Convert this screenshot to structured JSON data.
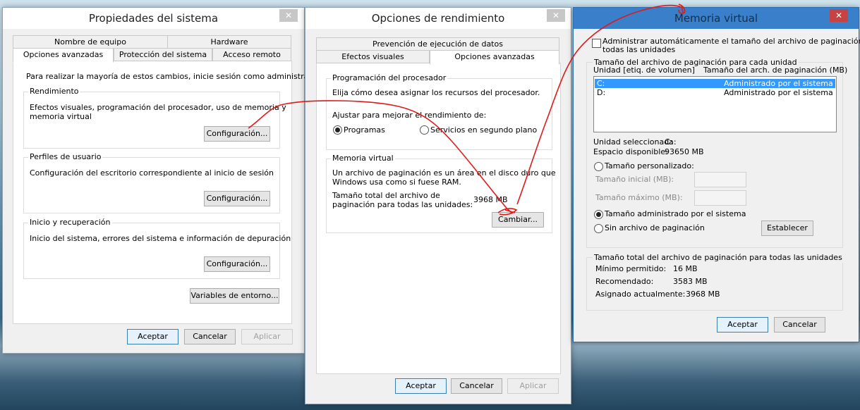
{
  "win1": {
    "title": "Propiedades del sistema",
    "tabs_row1": [
      "Nombre de equipo",
      "Hardware"
    ],
    "tabs_row2": [
      "Opciones avanzadas",
      "Protección del sistema",
      "Acceso remoto"
    ],
    "admin_note": "Para realizar la mayoría de estos cambios, inicie sesión como administrador.",
    "perf": {
      "label": "Rendimiento",
      "desc1": "Efectos visuales, programación del procesador, uso de memoria y",
      "desc2": "memoria virtual",
      "button": "Configuración..."
    },
    "profiles": {
      "label": "Perfiles de usuario",
      "desc": "Configuración del escritorio correspondiente al inicio de sesión",
      "button": "Configuración..."
    },
    "startup": {
      "label": "Inicio y recuperación",
      "desc": "Inicio del sistema, errores del sistema e información de depuración",
      "button": "Configuración..."
    },
    "env_button": "Variables de entorno...",
    "ok": "Aceptar",
    "cancel": "Cancelar",
    "apply": "Aplicar"
  },
  "win2": {
    "title": "Opciones de rendimiento",
    "tabs_row1": [
      "Prevención de ejecución de datos"
    ],
    "tabs_row2": [
      "Efectos visuales",
      "Opciones avanzadas"
    ],
    "cpu": {
      "label": "Programación del procesador",
      "desc": "Elija cómo desea asignar los recursos del procesador.",
      "adjust": "Ajustar para mejorar el rendimiento de:",
      "opt1": "Programas",
      "opt2": "Servicios en segundo plano"
    },
    "vm": {
      "label": "Memoria virtual",
      "desc1": "Un archivo de paginación es un área en el disco duro que",
      "desc2": "Windows usa como si fuese RAM.",
      "total1": "Tamaño total del archivo de",
      "total2": "paginación para todas las unidades:",
      "total_value": "3968 MB",
      "change": "Cambiar..."
    },
    "ok": "Aceptar",
    "cancel": "Cancelar",
    "apply": "Aplicar"
  },
  "win3": {
    "title": "Memoria virtual",
    "auto1": "Administrar automáticamente el tamaño del archivo de paginación para",
    "auto2": "todas las unidades",
    "per_drive": "Tamaño del archivo de paginación para cada unidad",
    "col1": "Unidad [etiq. de volumen]",
    "col2": "Tamaño del arch. de paginación (MB)",
    "drives": [
      {
        "drive": "C:",
        "size": "Administrado por el sistema"
      },
      {
        "drive": "D:",
        "size": "Administrado por el sistema"
      }
    ],
    "sel_label": "Unidad seleccionada:",
    "sel_value": "C:",
    "space_label": "Espacio disponible:",
    "space_value": "93650 MB",
    "custom": "Tamaño personalizado:",
    "initial": "Tamaño inicial (MB):",
    "max": "Tamaño máximo (MB):",
    "system_managed": "Tamaño administrado por el sistema",
    "no_file": "Sin archivo de paginación",
    "set": "Establecer",
    "totals_label": "Tamaño total del archivo de paginación para todas las unidades",
    "min_label": "Mínimo permitido:",
    "min_value": "16 MB",
    "rec_label": "Recomendado:",
    "rec_value": "3583 MB",
    "cur_label": "Asignado actualmente:",
    "cur_value": "3968 MB",
    "ok": "Aceptar",
    "cancel": "Cancelar"
  },
  "close_glyph": "✕",
  "colors": {
    "annotation": "#e0191b",
    "selection": "#3399ff",
    "title_blue": "#3a7fc9"
  }
}
